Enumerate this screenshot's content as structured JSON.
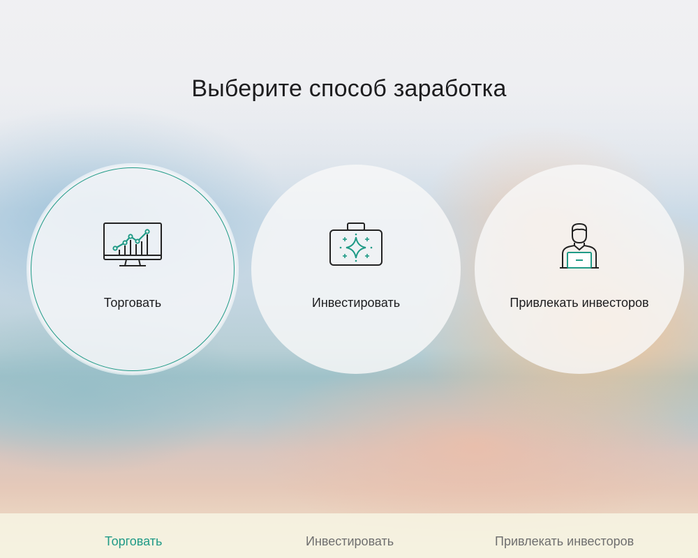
{
  "page": {
    "title": "Выберите способ заработка"
  },
  "options": [
    {
      "label": "Торговать",
      "icon": "chart-monitor-icon",
      "active": true
    },
    {
      "label": "Инвестировать",
      "icon": "briefcase-sparkle-icon",
      "active": false
    },
    {
      "label": "Привлекать инвесторов",
      "icon": "manager-laptop-icon",
      "active": false
    }
  ],
  "footer_nav": [
    {
      "label": "Торговать",
      "active": true
    },
    {
      "label": "Инвестировать",
      "active": false
    },
    {
      "label": "Привлекать инвесторов",
      "active": false
    }
  ],
  "colors": {
    "accent": "#1f9a86",
    "text": "#1d1d1f",
    "muted_text": "#6f6f6f"
  }
}
